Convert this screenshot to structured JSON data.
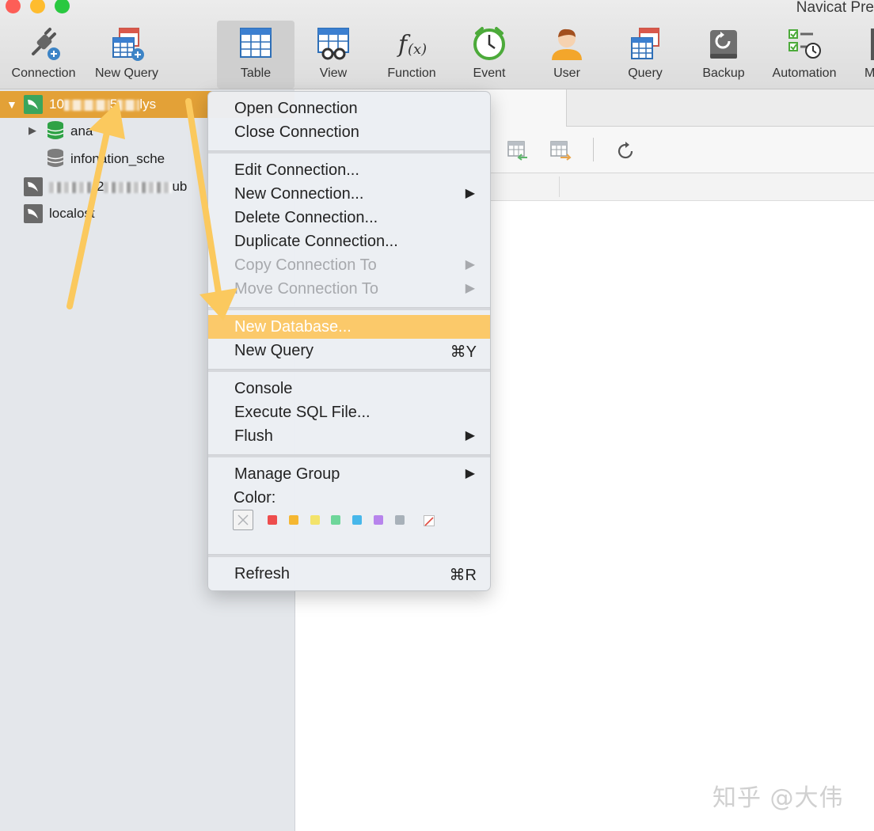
{
  "window": {
    "app_title": "Navicat Pre"
  },
  "toolbar": {
    "items": [
      {
        "label": "Connection"
      },
      {
        "label": "New Query"
      },
      {
        "label": "Table"
      },
      {
        "label": "View"
      },
      {
        "label": "Function"
      },
      {
        "label": "Event"
      },
      {
        "label": "User"
      },
      {
        "label": "Query"
      },
      {
        "label": "Backup"
      },
      {
        "label": "Automation"
      },
      {
        "label": "M"
      }
    ]
  },
  "sidebar": {
    "connection_1": {
      "prefix": "10",
      "middle": "5",
      "suffix": "lys"
    },
    "databases": [
      {
        "label": "ana"
      },
      {
        "label_a": "info",
        "label_b": "nation_sche"
      }
    ],
    "connection_2": {
      "middle": "2",
      "suffix": "ub"
    },
    "connection_3": {
      "label_a": "local",
      "label_b": "ost"
    }
  },
  "context_menu": {
    "group1": [
      {
        "label": "Open Connection"
      },
      {
        "label": "Close Connection"
      }
    ],
    "group2": [
      {
        "label": "Edit Connection..."
      },
      {
        "label": "New Connection...",
        "submenu": "▶"
      },
      {
        "label": "Delete Connection..."
      },
      {
        "label": "Duplicate Connection..."
      },
      {
        "label": "Copy Connection To",
        "submenu": "▶"
      },
      {
        "label": "Move Connection To",
        "submenu": "▶"
      }
    ],
    "group3": [
      {
        "label": "New Database..."
      },
      {
        "label": "New Query",
        "shortcut": "⌘Y"
      }
    ],
    "group4": [
      {
        "label": "Console"
      },
      {
        "label": "Execute SQL File..."
      },
      {
        "label": "Flush",
        "submenu": "▶"
      }
    ],
    "group5": {
      "manage_group": {
        "label": "Manage Group",
        "submenu": "▶"
      },
      "color_label": "Color:",
      "swatches": [
        "#ee4d4d",
        "#f5b731",
        "#f3e36b",
        "#6ed69a",
        "#47b7ea",
        "#b784ec",
        "#a8b1b9"
      ]
    },
    "group6": [
      {
        "label": "Refresh",
        "shortcut": "⌘R"
      }
    ]
  },
  "watermark": "知乎 @大伟",
  "colors": {
    "selection": "#e3a137",
    "menu_highlight": "#fbc96a",
    "annotation_arrow": "#fbc95e"
  }
}
